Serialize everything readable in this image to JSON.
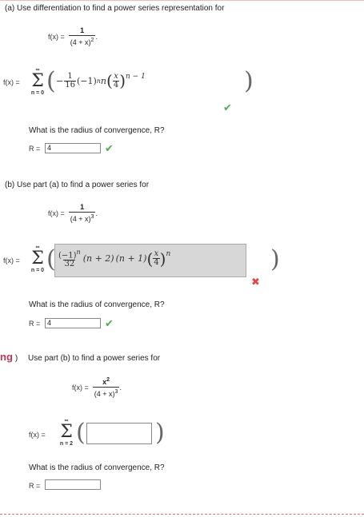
{
  "part_a": {
    "prompt": "(a)  Use differentiation to find a power series representation for",
    "f_label": "f(x) =",
    "f_num": "1",
    "f_den_base": "(4 + x)",
    "f_den_exp": "2",
    "f_tail": ".",
    "sum_label": "f(x) =",
    "sum_upper": "∞",
    "sum_lower": "n = 0",
    "answer": {
      "sign": "−",
      "coef_num": "1",
      "coef_den": "16",
      "base": "(−1)",
      "pow": "n",
      "mult": "n",
      "x_num": "x",
      "x_den": "4",
      "exp": "n − 1"
    },
    "radius_question": "What is the radius of convergence, R?",
    "radius_label": "R =",
    "radius_value": "4"
  },
  "part_b": {
    "prompt": "(b)  Use part (a) to find a power series for",
    "f_label": "f(x) =",
    "f_num": "1",
    "f_den_base": "(4 + x)",
    "f_den_exp": "3",
    "f_tail": ".",
    "sum_label": "f(x) =",
    "sum_upper": "∞",
    "sum_lower": "n = 0",
    "answer": {
      "num_base": "(−1)",
      "num_pow": "n",
      "den": "32",
      "factor1": "(n + 2)",
      "factor2": "(n + 1)",
      "x_num": "x",
      "x_den": "4",
      "exp": "n"
    },
    "radius_question": "What is the radius of convergence, R?",
    "radius_label": "R =",
    "radius_value": "4"
  },
  "part_c": {
    "prefix": "ng",
    "prompt": "Use part (b) to find a power series for",
    "f_label": "f(x) =",
    "f_num_base": "x",
    "f_num_exp": "2",
    "f_den_base": "(4 + x)",
    "f_den_exp": "3",
    "f_tail": ".",
    "sum_label": "f(x) =",
    "sum_upper": "∞",
    "sum_lower": "n = 2",
    "radius_question": "What is the radius of convergence, R?",
    "radius_label": "R =",
    "radius_value": ""
  },
  "icons": {
    "check": "✔",
    "cross": "✖",
    "check_color": "#4caf50",
    "cross_color": "#e04848"
  }
}
